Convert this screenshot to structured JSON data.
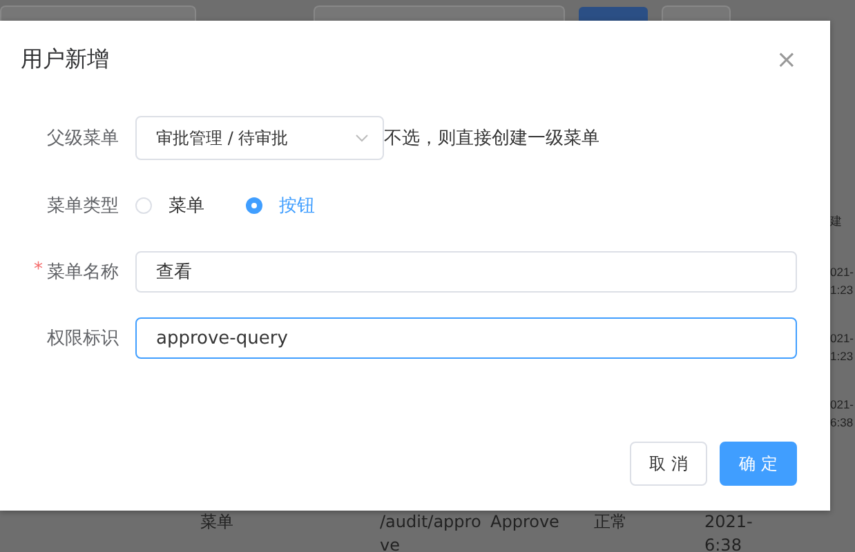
{
  "background": {
    "right_column": [
      "建",
      "021-",
      "1:23",
      "021-",
      "1:23",
      "021-",
      "6:38"
    ],
    "bottom_row": [
      {
        "lines": [
          "菜单"
        ]
      },
      {
        "lines": [
          "/audit/appro",
          "ve"
        ]
      },
      {
        "lines": [
          "Approve"
        ]
      },
      {
        "lines": [
          "正常"
        ]
      },
      {
        "lines": [
          "2021-",
          "6:38"
        ]
      }
    ]
  },
  "dialog": {
    "title": "用户新增",
    "close": "×",
    "fields": [
      {
        "kind": "select",
        "label": "父级菜单",
        "value": "审批管理 / 待审批",
        "hint": "不选，则直接创建一级菜单"
      },
      {
        "kind": "radio",
        "label": "菜单类型",
        "options": [
          {
            "label": "菜单",
            "selected": false
          },
          {
            "label": "按钮",
            "selected": true
          }
        ]
      },
      {
        "kind": "input",
        "label": "菜单名称",
        "required_mark": "*",
        "value": "查看",
        "focused": false
      },
      {
        "kind": "input",
        "label": "权限标识",
        "value": "approve-query",
        "focused": true
      }
    ],
    "buttons": [
      {
        "label": "取 消",
        "primary": false
      },
      {
        "label": "确 定",
        "primary": true
      }
    ]
  }
}
